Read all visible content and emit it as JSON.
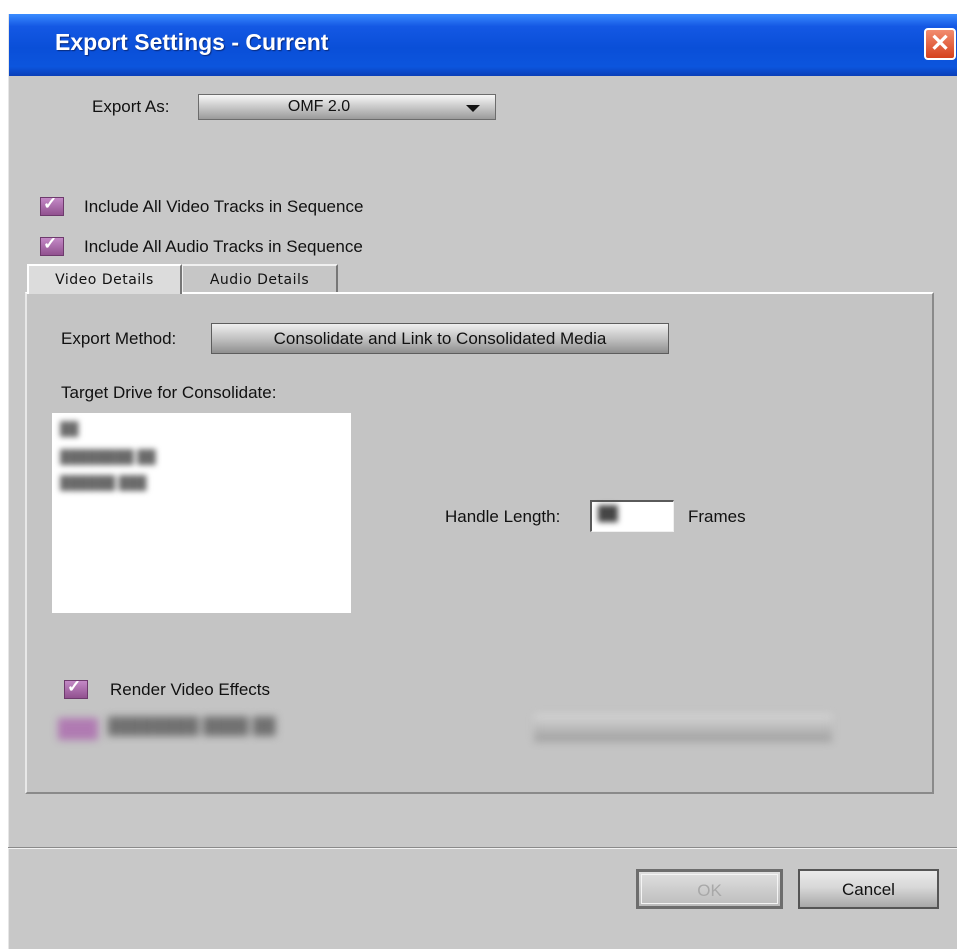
{
  "window": {
    "title": "Export Settings - Current",
    "close_glyph": "✕"
  },
  "export_as": {
    "label": "Export As:",
    "value": "OMF 2.0"
  },
  "checkboxes": {
    "include_video": {
      "label": "Include All Video Tracks in Sequence",
      "checked": true
    },
    "include_audio": {
      "label": "Include All Audio Tracks in Sequence",
      "checked": true
    },
    "render_video_effects": {
      "label": "Render Video Effects",
      "checked": true
    }
  },
  "tabs": [
    {
      "label": "Video Details",
      "active": true
    },
    {
      "label": "Audio Details",
      "active": false
    }
  ],
  "video_details": {
    "export_method_label": "Export Method:",
    "export_method_value": "Consolidate and Link to Consolidated Media",
    "target_drive_label": "Target Drive for Consolidate:",
    "handle_length_label": "Handle Length:",
    "handle_length_units": "Frames"
  },
  "buttons": {
    "ok": "OK",
    "cancel": "Cancel"
  },
  "icons": {
    "dropdown": "dropdown-arrow-icon",
    "check": "checkmark-icon",
    "close": "close-icon"
  },
  "colors": {
    "titlebar": "#0a4fd8",
    "checkbox": "#a76aa8",
    "close_button": "#e0542e",
    "dialog_background": "#c8c8c8"
  }
}
